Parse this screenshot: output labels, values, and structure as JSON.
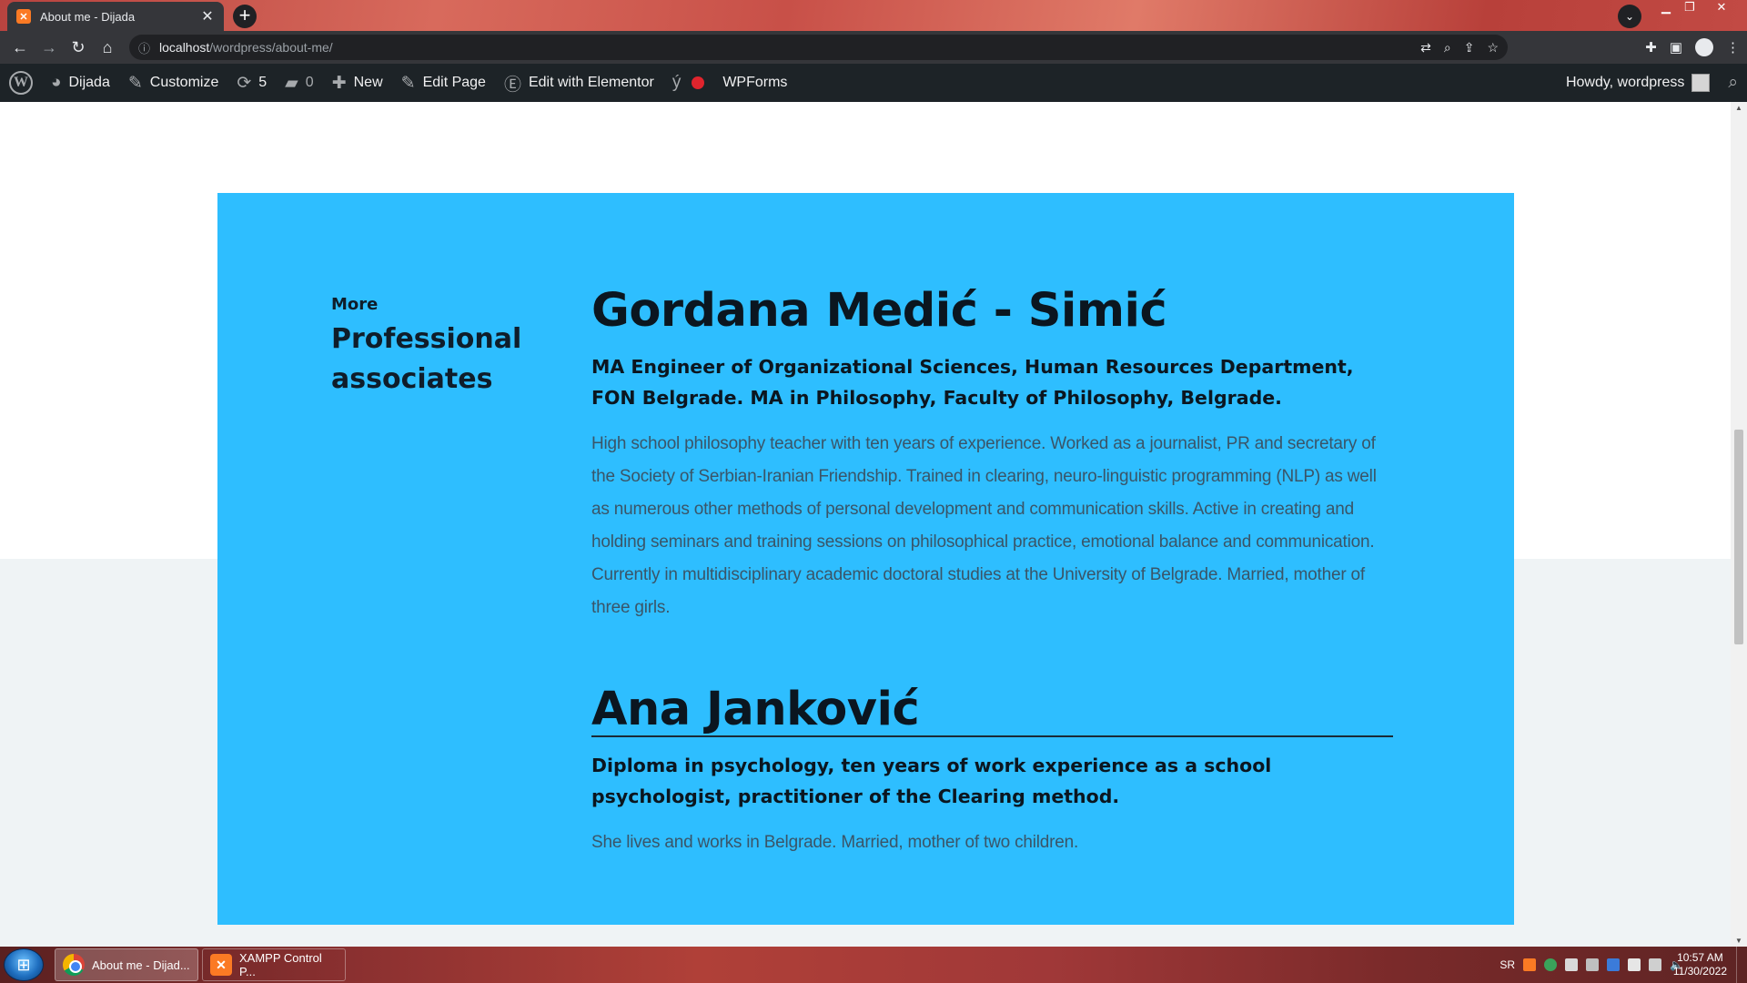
{
  "browser": {
    "tab_title": "About me - Dijada",
    "tab_favicon": "xampp-icon",
    "url_host": "localhost",
    "url_path": "/wordpress/about-me/"
  },
  "admin_bar": {
    "site_name": "Dijada",
    "customize": "Customize",
    "updates_count": "5",
    "comments_count": "0",
    "new": "New",
    "edit_page": "Edit Page",
    "elementor": "Edit with Elementor",
    "wpforms": "WPForms",
    "howdy": "Howdy, wordpress"
  },
  "section": {
    "kicker": "More",
    "title": "Professional associates",
    "accent_color": "#2ebeff"
  },
  "people": [
    {
      "name": "Gordana Medić - Simić",
      "degree": "MA Engineer of Organizational Sciences, Human Resources Department, FON Belgrade. MA in Philosophy, Faculty of Philosophy, Belgrade.",
      "bio": "High school philosophy teacher with ten years of experience. Worked as a journalist, PR and secretary of the Society of Serbian-Iranian Friendship. Trained in clearing, neuro-linguistic programming (NLP) as well as numerous other methods of personal development and communication skills. Active in creating and holding seminars and training sessions on philosophical practice, emotional balance and communication. Currently in multidisciplinary academic doctoral studies at the University of Belgrade. Married, mother of three girls."
    },
    {
      "name": "Ana Janković",
      "degree": "Diploma in psychology, ten years of work experience as a school psychologist, practitioner of the Clearing method.",
      "bio": "She lives and works in Belgrade. Married, mother of two children."
    }
  ],
  "taskbar": {
    "chrome_task": "About me - Dijad...",
    "xampp_task": "XAMPP Control P...",
    "language": "SR",
    "time": "10:57 AM",
    "date": "11/30/2022"
  }
}
